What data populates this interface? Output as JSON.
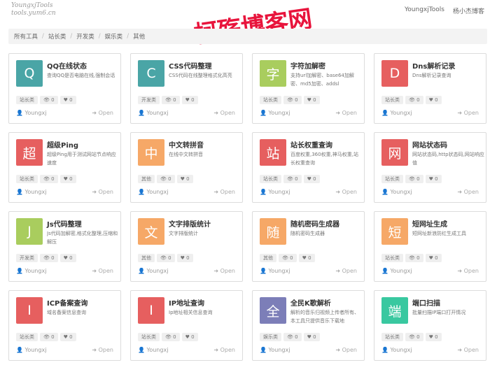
{
  "header": {
    "logo_lines": [
      "YoungxjTools",
      "tools.yum6.cn"
    ],
    "nav": [
      "YoungxjTools",
      "杨小杰博客"
    ],
    "watermark": "柯殇博客网"
  },
  "breadcrumb": [
    "所有工具",
    "站长类",
    "开发类",
    "娱乐类",
    "其他"
  ],
  "colors": {
    "red": "#e65f5f",
    "teal": "#4aa5a6",
    "green": "#a9cd5e",
    "orange": "#f6a867",
    "purple": "#7c7eb8",
    "mint": "#39c8a0"
  },
  "cards": [
    {
      "glyph": "Q",
      "color": "#4aa5a6",
      "title": "QQ在线状态",
      "desc": "查询QQ是否电脑在线,强制会话",
      "category": "站长类",
      "views": "0",
      "likes": "0",
      "author": "Youngxj",
      "open": "Open"
    },
    {
      "glyph": "C",
      "color": "#4aa5a6",
      "title": "CSS代码整理",
      "desc": "CSS代码在线整理格式化高亮",
      "category": "开发类",
      "views": "0",
      "likes": "0",
      "author": "Youngxj",
      "open": "Open"
    },
    {
      "glyph": "字",
      "color": "#a9cd5e",
      "title": "字符加解密",
      "desc": "支持url加解密、base64加解密、md5加密、addsl",
      "category": "站长类",
      "views": "0",
      "likes": "0",
      "author": "Youngxj",
      "open": "Open"
    },
    {
      "glyph": "D",
      "color": "#e65f5f",
      "title": "Dns解析记录",
      "desc": "Dns解析记录查询",
      "category": "站长类",
      "views": "0",
      "likes": "0",
      "author": "Youngxj",
      "open": "Open"
    },
    {
      "glyph": "超",
      "color": "#e65f5f",
      "title": "超级Ping",
      "desc": "超级Ping用于测试网站节点响应速度",
      "category": "站长类",
      "views": "0",
      "likes": "0",
      "author": "Youngxj",
      "open": "Open"
    },
    {
      "glyph": "中",
      "color": "#f6a867",
      "title": "中文转拼音",
      "desc": "在线中文转拼音",
      "category": "其他",
      "views": "0",
      "likes": "0",
      "author": "Youngxj",
      "open": "Open"
    },
    {
      "glyph": "站",
      "color": "#e65f5f",
      "title": "站长权重查询",
      "desc": "百度权重,360权重,神马权重,站长权重查询",
      "category": "站长类",
      "views": "0",
      "likes": "0",
      "author": "Youngxj",
      "open": "Open"
    },
    {
      "glyph": "网",
      "color": "#e65f5f",
      "title": "网站状态码",
      "desc": "网站状态码,http状态码,网站响应值",
      "category": "站长类",
      "views": "0",
      "likes": "0",
      "author": "Youngxj",
      "open": "Open"
    },
    {
      "glyph": "J",
      "color": "#a9cd5e",
      "title": "Js代码整理",
      "desc": "Js代码加解密,格式化整理,压缩和解压",
      "category": "开发类",
      "views": "0",
      "likes": "0",
      "author": "Youngxj",
      "open": "Open"
    },
    {
      "glyph": "文",
      "color": "#f6a867",
      "title": "文字排版统计",
      "desc": "文字排版统计",
      "category": "其他",
      "views": "0",
      "likes": "0",
      "author": "Youngxj",
      "open": "Open"
    },
    {
      "glyph": "随",
      "color": "#f6a867",
      "title": "随机密码生成器",
      "desc": "随机密码生成器",
      "category": "其他",
      "views": "0",
      "likes": "0",
      "author": "Youngxj",
      "open": "Open"
    },
    {
      "glyph": "短",
      "color": "#f6a867",
      "title": "短网址生成",
      "desc": "短网址新浪防红生成工具",
      "category": "站长类",
      "views": "0",
      "likes": "0",
      "author": "Youngxj",
      "open": "Open"
    },
    {
      "glyph": "I",
      "color": "#e65f5f",
      "title": "ICP备案查询",
      "desc": "域名备案信息查询",
      "category": "站长类",
      "views": "0",
      "likes": "0",
      "author": "Youngxj",
      "open": "Open"
    },
    {
      "glyph": "I",
      "color": "#e65f5f",
      "title": "IP地址查询",
      "desc": "Ip地址相关信息查询",
      "category": "站长类",
      "views": "0",
      "likes": "0",
      "author": "Youngxj",
      "open": "Open"
    },
    {
      "glyph": "全",
      "color": "#7c7eb8",
      "title": "全民K歌解析",
      "desc": "解析的音乐归视频上传者所有、本工具只提供音乐下载地",
      "category": "娱乐类",
      "views": "0",
      "likes": "0",
      "author": "Youngxj",
      "open": "Open"
    },
    {
      "glyph": "端",
      "color": "#39c8a0",
      "title": "端口扫描",
      "desc": "批量扫描IP端口打开情况",
      "category": "站长类",
      "views": "0",
      "likes": "0",
      "author": "Youngxj",
      "open": "Open"
    }
  ]
}
